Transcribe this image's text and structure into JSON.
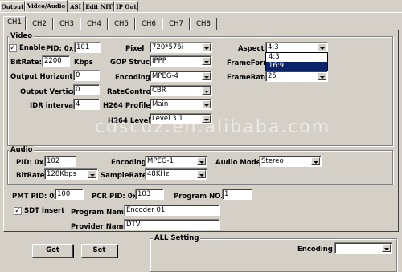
{
  "top_tabs": [
    "Output",
    "Video/Audio",
    "ASI",
    "Edit NIT",
    "IP Out"
  ],
  "channel_tabs": [
    "CH1",
    "CH2",
    "CH3",
    "CH4",
    "CH5",
    "CH6",
    "CH7",
    "CH8"
  ],
  "video": {
    "title": "Video",
    "enable_label": "Enable",
    "enable_checked": "✓",
    "pid_label": "PID: 0x",
    "pid_value": "101",
    "bitrate_label": "BitRate:",
    "bitrate_value": "2200",
    "bitrate_unit": "Kbps",
    "out_h_label": "Output Horizontal:",
    "out_h_value": "0",
    "out_v_label": "Output Vertical:",
    "out_v_value": "0",
    "idr_label": "IDR interval:",
    "idr_value": "4",
    "pixel_label": "Pixel",
    "pixel_value": "720*576i",
    "gop_label": "GOP Struct:",
    "gop_value": "IPPP",
    "encoding_label": "Encoding",
    "encoding_value": "MPEG-4",
    "ratecontrol_label": "RateControl:",
    "ratecontrol_value": "CBR",
    "h264profile_label": "H264 Profile:",
    "h264profile_value": "Main",
    "h264level_label": "H264 Level:",
    "h264level_value": "Level 3.1",
    "aspect_label": "Aspect:",
    "aspect_value": "4:3",
    "aspect_options": [
      "4:3",
      "16:9"
    ],
    "frameformat_label": "FrameFormat:",
    "framerate_label": "FrameRate",
    "framerate_value": "25"
  },
  "audio": {
    "title": "Audio",
    "pid_label": "PID: 0x",
    "pid_value": "102",
    "encoding_label": "Encoding",
    "encoding_value": "MPEG-1",
    "mode_label": "Audio Mode",
    "mode_value": "Stereo",
    "bitrate_label": "BitRate:",
    "bitrate_value": "128Kbps",
    "samplerate_label": "SampleRate:",
    "samplerate_value": "48KHz"
  },
  "program": {
    "pmt_label": "PMT PID: 0x",
    "pmt_value": "100",
    "pcr_label": "PCR PID: 0x",
    "pcr_value": "103",
    "progno_label": "Program NO.:",
    "progno_value": "1",
    "sdt_label": "SDT Insert",
    "sdt_checked": "✓",
    "name_label": "Program Name:",
    "name_value": "Encoder 01",
    "provider_label": "Provider Name:",
    "provider_value": "DTV"
  },
  "buttons": {
    "get": "Get",
    "set": "Set"
  },
  "all_setting": {
    "title": "ALL Setting",
    "encoding_label": "Encoding",
    "encoding_value": ""
  },
  "watermark": "cdscdz.en.alibaba.com"
}
